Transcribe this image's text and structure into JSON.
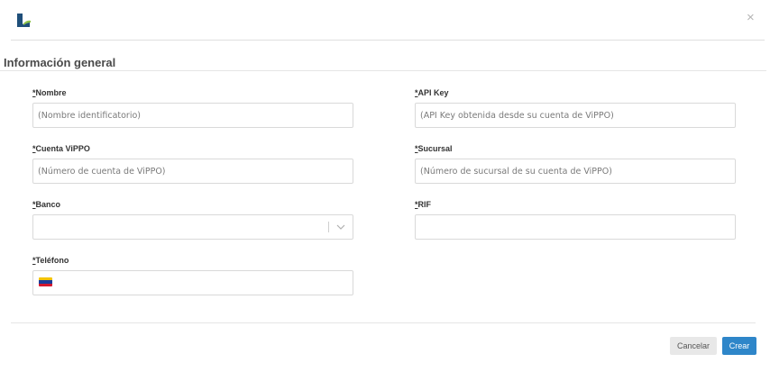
{
  "header": {
    "close_glyph": "×"
  },
  "section": {
    "title": "Información general"
  },
  "fields": {
    "nombre": {
      "required_mark": "*",
      "label": "Nombre",
      "value": "",
      "placeholder": "(Nombre identificatorio)"
    },
    "api_key": {
      "required_mark": "*",
      "label": "API Key",
      "value": "",
      "placeholder": "(API Key obtenida desde su cuenta de ViPPO)"
    },
    "cuenta": {
      "required_mark": "*",
      "label": "Cuenta ViPPO",
      "value": "",
      "placeholder": "(Número de cuenta de ViPPO)"
    },
    "sucursal": {
      "required_mark": "*",
      "label": "Sucursal",
      "value": "",
      "placeholder": "(Número de sucursal de su cuenta de ViPPO)"
    },
    "banco": {
      "required_mark": "*",
      "label": "Banco",
      "value": ""
    },
    "rif": {
      "required_mark": "*",
      "label": "RIF",
      "value": ""
    },
    "telefono": {
      "required_mark": "*",
      "label": "Teléfono",
      "value": "",
      "flag_icon": "venezuela-flag-icon"
    }
  },
  "footer": {
    "cancel_label": "Cancelar",
    "create_label": "Crear"
  },
  "colors": {
    "primary": "#2e86c9",
    "logo_dark": "#1f4f7a",
    "logo_accent": "#8fc34a"
  }
}
